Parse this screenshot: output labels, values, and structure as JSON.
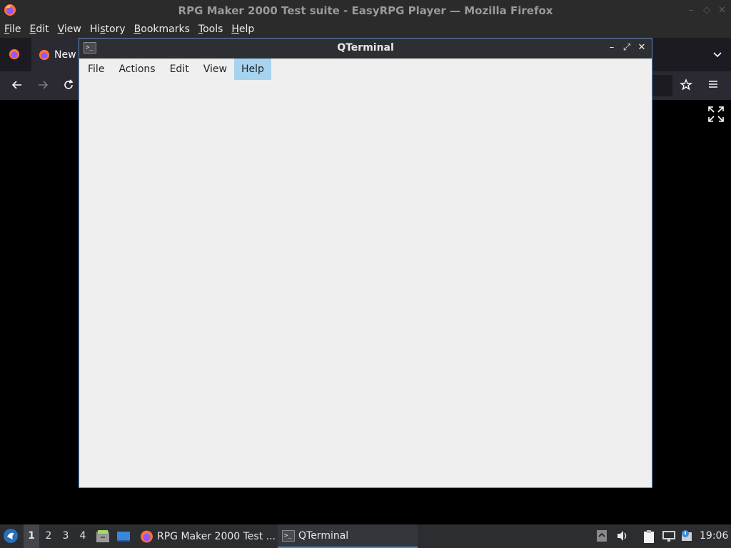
{
  "firefox": {
    "window_title": "RPG Maker 2000 Test suite - EasyRPG Player — Mozilla Firefox",
    "menu": [
      {
        "label": "File",
        "mnemonic": "F"
      },
      {
        "label": "Edit",
        "mnemonic": "E"
      },
      {
        "label": "View",
        "mnemonic": "V"
      },
      {
        "label": "History",
        "mnemonic": "s"
      },
      {
        "label": "Bookmarks",
        "mnemonic": "B"
      },
      {
        "label": "Tools",
        "mnemonic": "T"
      },
      {
        "label": "Help",
        "mnemonic": "H"
      }
    ],
    "new_tab_label": "New",
    "window_controls": [
      "–",
      "◇",
      "✕"
    ]
  },
  "qterminal": {
    "window_title": "QTerminal",
    "menu": [
      "File",
      "Actions",
      "Edit",
      "View",
      "Help"
    ],
    "active_menu": "Help",
    "controls": {
      "minimize": "–",
      "maximize": "⤢",
      "close": "✕"
    }
  },
  "taskbar": {
    "desktops": [
      "1",
      "2",
      "3",
      "4"
    ],
    "active_desktop": "1",
    "tasks": [
      {
        "label": "RPG Maker 2000 Test ...",
        "icon": "firefox-icon",
        "active": false
      },
      {
        "label": "QTerminal",
        "icon": "terminal-icon",
        "active": true
      }
    ],
    "clock": "19:06"
  },
  "colors": {
    "accent": "#3b8ed6",
    "menu_highlight": "#a7d3ee",
    "window_border": "#5a86c0"
  }
}
